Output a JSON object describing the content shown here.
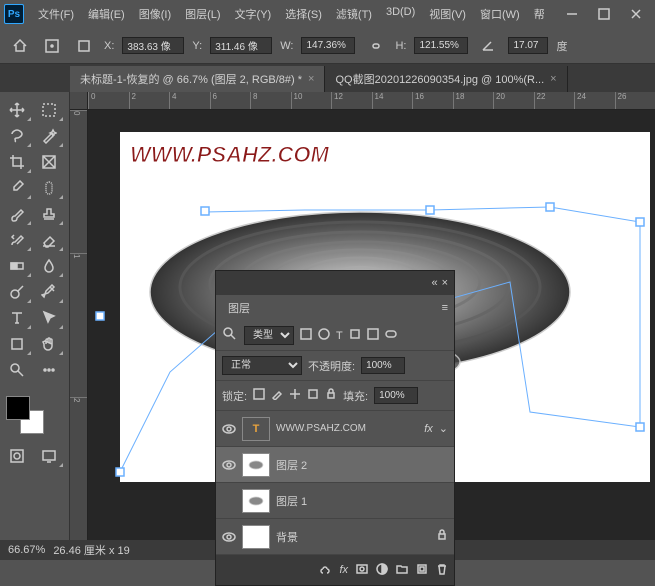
{
  "app": {
    "logo": "Ps"
  },
  "menu": {
    "file": "文件(F)",
    "edit": "编辑(E)",
    "image": "图像(I)",
    "layer": "图层(L)",
    "type": "文字(Y)",
    "select": "选择(S)",
    "filter": "滤镜(T)",
    "3d": "3D(D)",
    "view": "视图(V)",
    "window": "窗口(W)",
    "help": "帮"
  },
  "options": {
    "x_label": "X:",
    "x_val": "383.63 像",
    "y_label": "Y:",
    "y_val": "311.46 像",
    "w_label": "W:",
    "w_val": "147.36%",
    "h_label": "H:",
    "h_val": "121.55%",
    "angle_val": "17.07",
    "angle_label": "度"
  },
  "tabs": {
    "tab1": "未标题-1-恢复的 @ 66.7% (图层 2, RGB/8#) *",
    "tab2": "QQ截图20201226090354.jpg @ 100%(R..."
  },
  "ruler": {
    "h": [
      "0",
      "2",
      "4",
      "6",
      "8",
      "10",
      "12",
      "14",
      "16",
      "18",
      "20",
      "22",
      "24",
      "26"
    ],
    "v": [
      "0",
      "1",
      "2"
    ]
  },
  "canvas": {
    "watermark": "WWW.PSAHZ.COM"
  },
  "status": {
    "zoom": "66.67%",
    "doc": "26.46 厘米 x 19"
  },
  "layers": {
    "title": "图层",
    "filter_placeholder": "类型",
    "blend": "正常",
    "opacity_label": "不透明度:",
    "opacity_val": "100%",
    "lock_label": "锁定:",
    "fill_label": "填充:",
    "fill_val": "100%",
    "items": [
      {
        "name": "WWW.PSAHZ.COM",
        "fx": "fx",
        "type": "text"
      },
      {
        "name": "图层 2",
        "selected": true
      },
      {
        "name": "图层 1"
      },
      {
        "name": "背景",
        "locked": true
      }
    ]
  }
}
